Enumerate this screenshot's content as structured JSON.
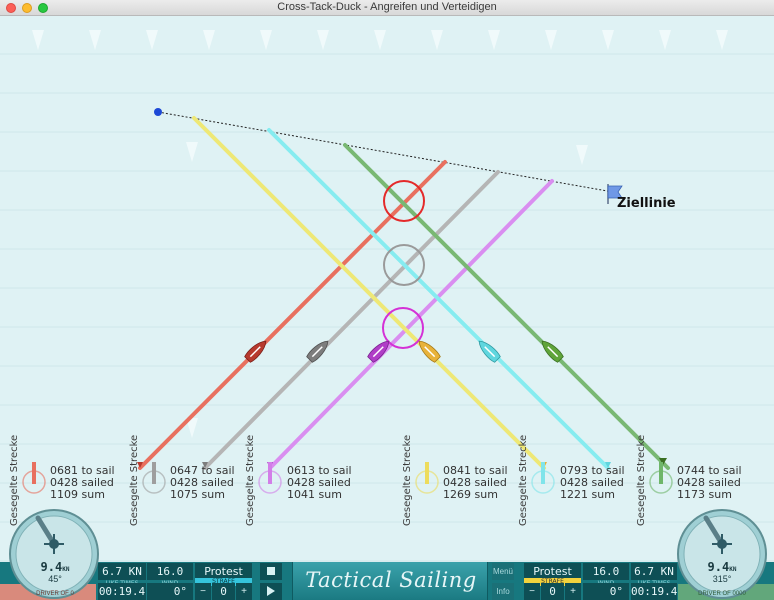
{
  "window": {
    "title": "Cross-Tack-Duck - Angreifen und Verteidigen"
  },
  "finish": {
    "label": "Ziellinie"
  },
  "boats": [
    {
      "color": "#e8705f",
      "stat_label": "Gesegelte Strecke",
      "to_sail": "0681 to sail",
      "sailed": "0428 sailed",
      "sum": "1109 sum"
    },
    {
      "color": "#9e9e9e",
      "stat_label": "Gesegelte Strecke",
      "to_sail": "0647 to sail",
      "sailed": "0428 sailed",
      "sum": "1075 sum"
    },
    {
      "color": "#d27ee8",
      "stat_label": "Gesegelte Strecke",
      "to_sail": "0613 to sail",
      "sailed": "0428 sailed",
      "sum": "1041 sum"
    },
    {
      "color": "#eddc5c",
      "stat_label": "Gesegelte Strecke",
      "to_sail": "0841 to sail",
      "sailed": "0428 sailed",
      "sum": "1269 sum"
    },
    {
      "color": "#7fe4ea",
      "stat_label": "Gesegelte Strecke",
      "to_sail": "0793 to sail",
      "sailed": "0428 sailed",
      "sum": "1221 sum"
    },
    {
      "color": "#6fb66a",
      "stat_label": "Gesegelte Strecke",
      "to_sail": "0744 to sail",
      "sailed": "0428 sailed",
      "sum": "1173 sum"
    }
  ],
  "hud": {
    "logo": "Tactical Sailing",
    "left": {
      "speed": "6.7 KN",
      "wind": "16.0 KN",
      "protest": "Protest",
      "strafe": "STRAFE",
      "time": "00:19.4",
      "angle": "0°",
      "minus": "−",
      "penalty": "0",
      "plus": "+",
      "speed_caption": "LIKE TIMES",
      "wind_caption": "WIND"
    },
    "right": {
      "menu": "Menü",
      "info": "Info",
      "protest": "Protest",
      "wind": "16.0 KN",
      "speed": "6.7 KN",
      "strafe": "STRAFE",
      "minus": "−",
      "penalty": "0",
      "plus": "+",
      "angle": "0°",
      "time": "00:19.4",
      "speed_caption": "LIKE TIMES",
      "wind_caption": "WIND"
    },
    "left_dial": {
      "speed": "9.4",
      "unit": "KN",
      "heading": "45°",
      "caption": "DRIVER OF 0"
    },
    "right_dial": {
      "speed": "9.4",
      "unit": "KN",
      "heading": "315°",
      "caption": "DRIVER OF 0000"
    },
    "stop_icon": "stop-icon",
    "play_icon": "play-icon"
  },
  "colors": {
    "hud": "#17787f",
    "water": "#dff2f4"
  }
}
